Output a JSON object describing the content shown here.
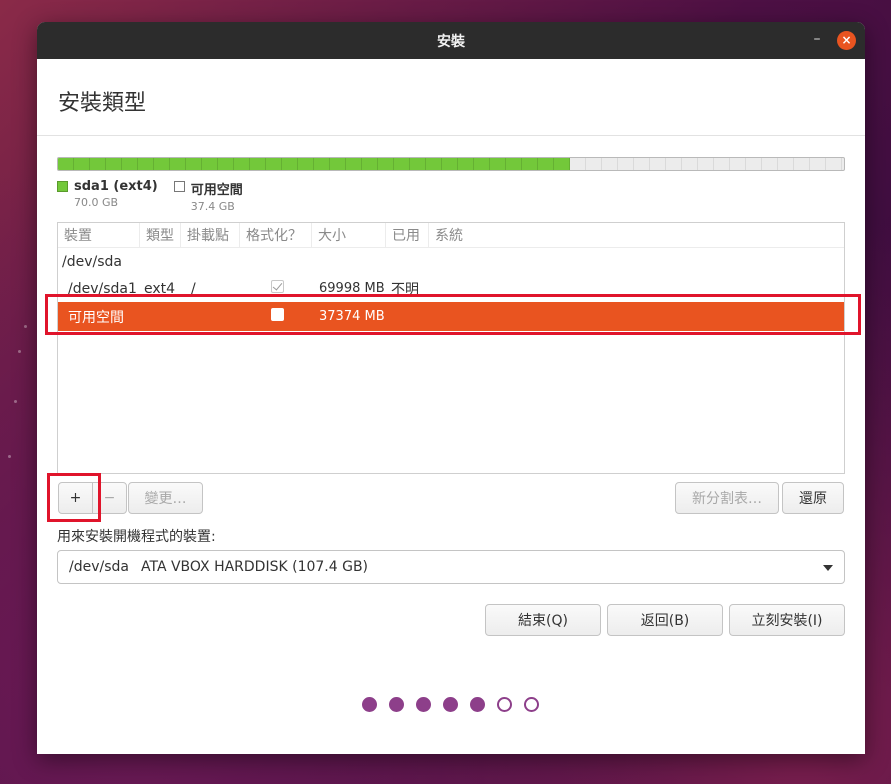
{
  "window": {
    "title": "安裝",
    "minimize_label": "–",
    "close_label": "×"
  },
  "header": {
    "title": "安裝類型"
  },
  "disk_bar": {
    "used_fraction": 0.652,
    "used_color": "#73c83a",
    "free_color": "#ececec"
  },
  "legend": [
    {
      "name": "sda1 (ext4)",
      "size": "70.0 GB",
      "color": "#73c83a"
    },
    {
      "name": "可用空間",
      "size": "37.4 GB",
      "color": "#ffffff"
    }
  ],
  "table": {
    "headers": [
      "裝置",
      "類型",
      "掛載點",
      "格式化？",
      "大小",
      "已用",
      "系統"
    ],
    "device_row": {
      "device": "/dev/sda"
    },
    "partition_row": {
      "device": "/dev/sda1",
      "type": "ext4",
      "mount": "/",
      "format_checked": true,
      "size": "69998 MB",
      "used": "不明",
      "system": ""
    },
    "free_row": {
      "device": "可用空間",
      "format_checked": false,
      "size": "37374 MB"
    }
  },
  "buttons": {
    "add": "+",
    "remove": "−",
    "change": "變更…",
    "new_table": "新分割表…",
    "revert": "還原",
    "quit": "結束(Q)",
    "back": "返回(B)",
    "install_now": "立刻安裝(I)"
  },
  "bootloader": {
    "label": "用來安裝開機程式的裝置:",
    "selected_device": "/dev/sda",
    "selected_desc": "ATA VBOX HARDDISK (107.4 GB)"
  },
  "progress": {
    "total_steps": 7,
    "completed_steps": 5,
    "color": "#8d3f8a"
  },
  "colors": {
    "accent": "#e95420",
    "highlight_box": "#e0142b"
  }
}
